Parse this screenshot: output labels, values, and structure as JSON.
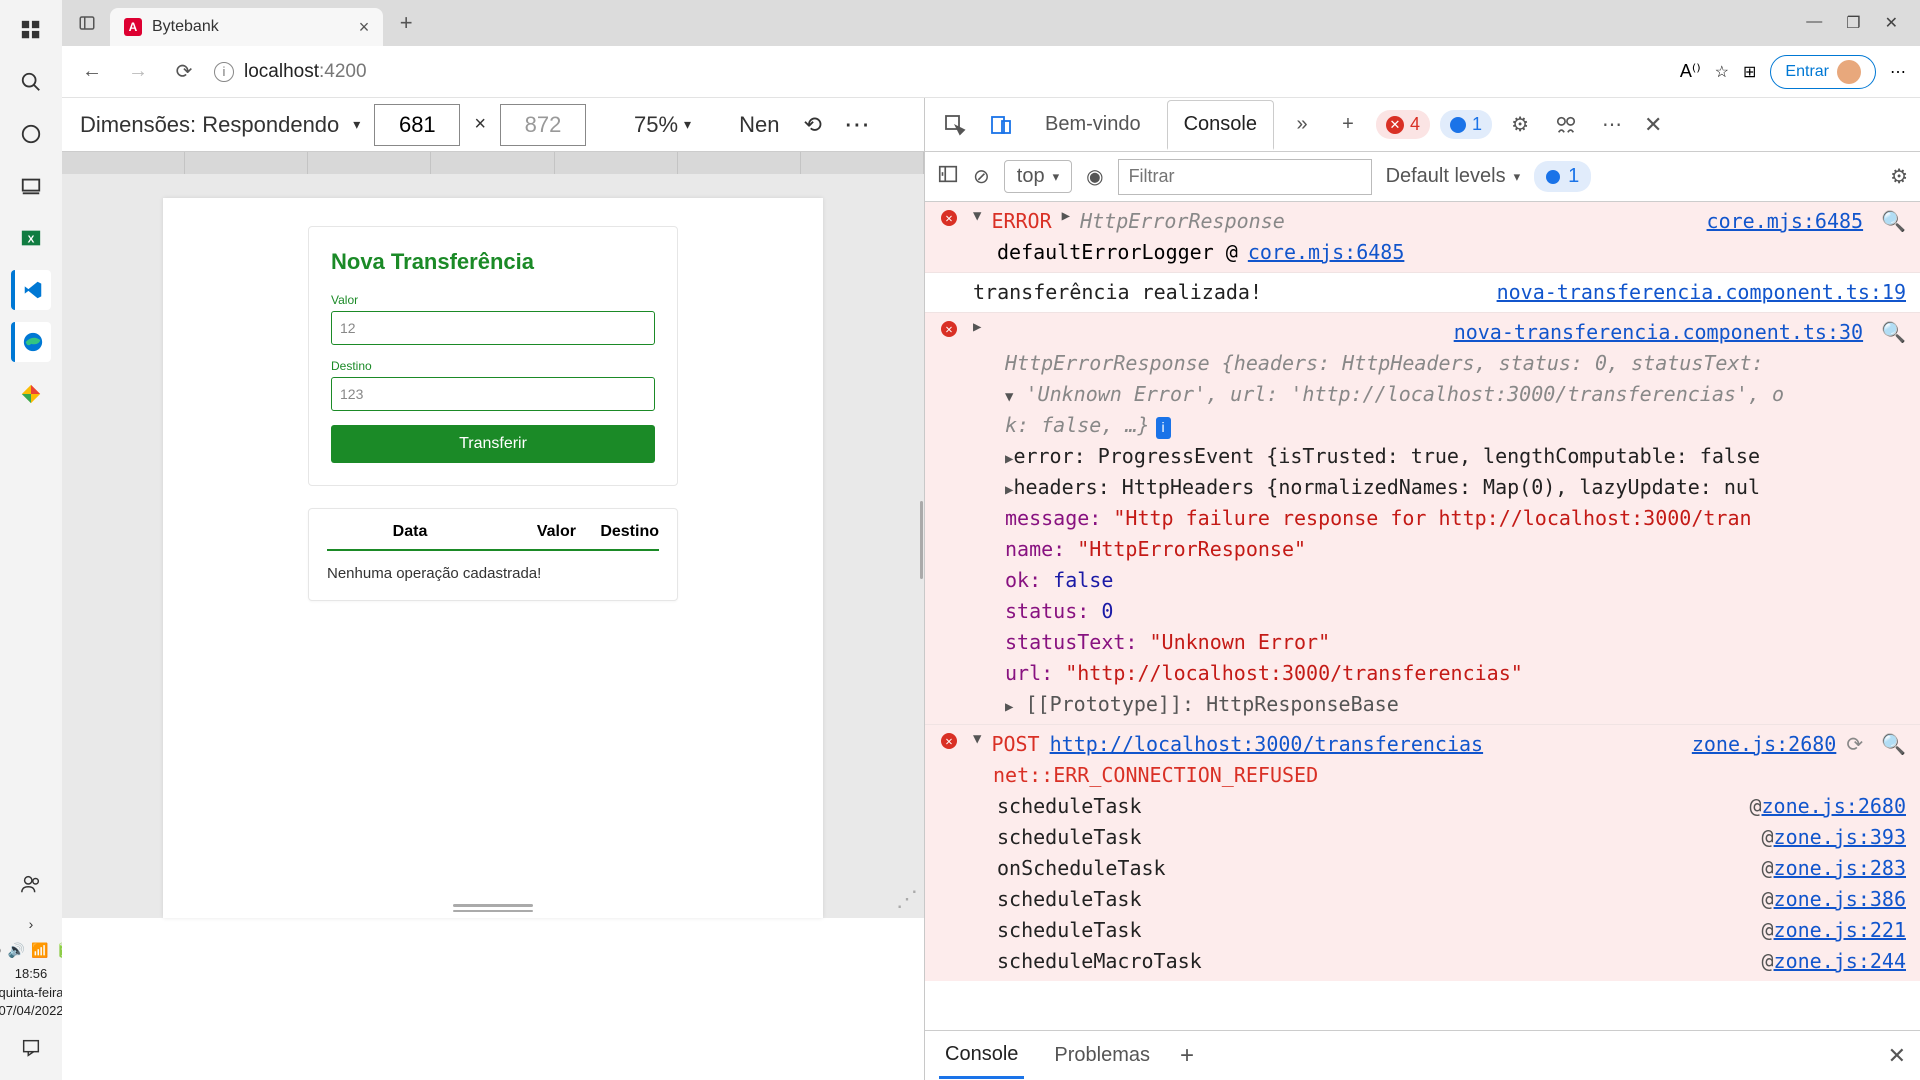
{
  "browser": {
    "tab_title": "Bytebank",
    "url_host": "localhost",
    "url_port": ":4200",
    "signin": "Entrar"
  },
  "win": {
    "time": "18:56",
    "weekday": "quinta-feira",
    "date": "07/04/2022"
  },
  "devbar": {
    "label": "Dimensões: Respondendo",
    "width": "681",
    "height": "872",
    "zoom": "75%",
    "extra": "Nen"
  },
  "app": {
    "title": "Nova Transferência",
    "valor_label": "Valor",
    "valor_value": "12",
    "destino_label": "Destino",
    "destino_value": "123",
    "button": "Transferir",
    "col_data": "Data",
    "col_valor": "Valor",
    "col_destino": "Destino",
    "empty": "Nenhuma operação cadastrada!"
  },
  "dt": {
    "tab_welcome": "Bem-vindo",
    "tab_console": "Console",
    "err_count": "4",
    "info_count": "1",
    "top": "top",
    "filter_ph": "Filtrar",
    "levels": "Default levels",
    "issue_count": "1",
    "drawer_console": "Console",
    "drawer_problems": "Problemas"
  },
  "console": {
    "e1_label": "ERROR",
    "e1_obj": "HttpErrorResponse",
    "e1_src": "core.mjs:6485",
    "e1_line2a": "defaultErrorLogger @ ",
    "e1_line2b": "core.mjs:6485",
    "e2_msg": "transferência realizada!",
    "e2_src": "nova-transferencia.component.ts:19",
    "e3_src": "nova-transferencia.component.ts:30",
    "e3_l1": "HttpErrorResponse {headers: HttpHeaders, status: 0, statusText:",
    "e3_l2": "'Unknown Error', url: 'http://localhost:3000/transferencias', o",
    "e3_l3": "k: false, …}",
    "e3_p1": "error: ProgressEvent {isTrusted: true, lengthComputable: false",
    "e3_p2": "headers: HttpHeaders {normalizedNames: Map(0), lazyUpdate: nul",
    "e3_p3k": "message:",
    "e3_p3v": "\"Http failure response for http://localhost:3000/tran",
    "e3_p4k": "name:",
    "e3_p4v": "\"HttpErrorResponse\"",
    "e3_p5k": "ok:",
    "e3_p5v": "false",
    "e3_p6k": "status:",
    "e3_p6v": "0",
    "e3_p7k": "statusText:",
    "e3_p7v": "\"Unknown Error\"",
    "e3_p8k": "url:",
    "e3_p8v": "\"http://localhost:3000/transferencias\"",
    "e3_proto": "[[Prototype]]: HttpResponseBase",
    "e4_method": "POST",
    "e4_url": "http://localhost:3000/transferencias",
    "e4_src": "zone.js:2680",
    "e4_net": "net::ERR_CONNECTION_REFUSED",
    "stack": [
      {
        "fn": "scheduleTask",
        "src": "zone.js:2680"
      },
      {
        "fn": "scheduleTask",
        "src": "zone.js:393"
      },
      {
        "fn": "onScheduleTask",
        "src": "zone.js:283"
      },
      {
        "fn": "scheduleTask",
        "src": "zone.js:386"
      },
      {
        "fn": "scheduleTask",
        "src": "zone.js:221"
      },
      {
        "fn": "scheduleMacroTask",
        "src": "zone.js:244"
      }
    ]
  }
}
